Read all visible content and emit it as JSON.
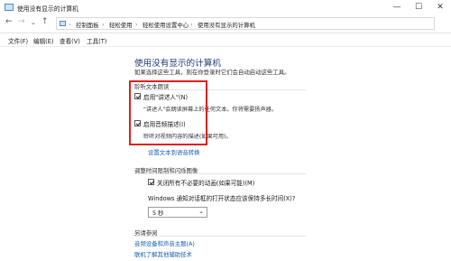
{
  "window": {
    "title": "使用没有显示的计算机",
    "controls": {
      "minimize": "—",
      "maximize": "☐",
      "close": "✕"
    }
  },
  "address": {
    "breadcrumbs": [
      "控制面板",
      "轻松使用",
      "轻松使用设置中心",
      "使用没有显示的计算机"
    ],
    "separator": "›"
  },
  "menu": [
    "文件(F)",
    "编辑(E)",
    "查看(V)",
    "工具(T)"
  ],
  "main": {
    "title": "使用没有显示的计算机",
    "description": "如果选择这些工具，则在你登录时它们会自动启动这些工具。",
    "narrator_section": {
      "label": "聆听文本朗读",
      "options": [
        {
          "label": "启用\"讲述人\"(N)",
          "checked": true,
          "description": "\"讲述人\"会朗读屏幕上的任何文本。你将需要扬声器。"
        },
        {
          "label": "启用音频描述(I)",
          "checked": true,
          "description": "聆听对视频内容的描述(如果可用)。"
        }
      ],
      "link": "设置文本到语音转换"
    },
    "timing_section": {
      "label": "调整时间限制和闪烁图像",
      "options": [
        {
          "label": "关闭所有不必要的动画(如果可能)(M)",
          "checked": true
        }
      ],
      "notify_label": "Windows 通知对话框的打开状态应该保持多长时间(X)?",
      "dropdown_value": "5 秒"
    },
    "see_also": {
      "label": "另请参阅",
      "links": [
        "音频设备和声音主题(A)",
        "联机了解其他辅助技术"
      ]
    }
  }
}
